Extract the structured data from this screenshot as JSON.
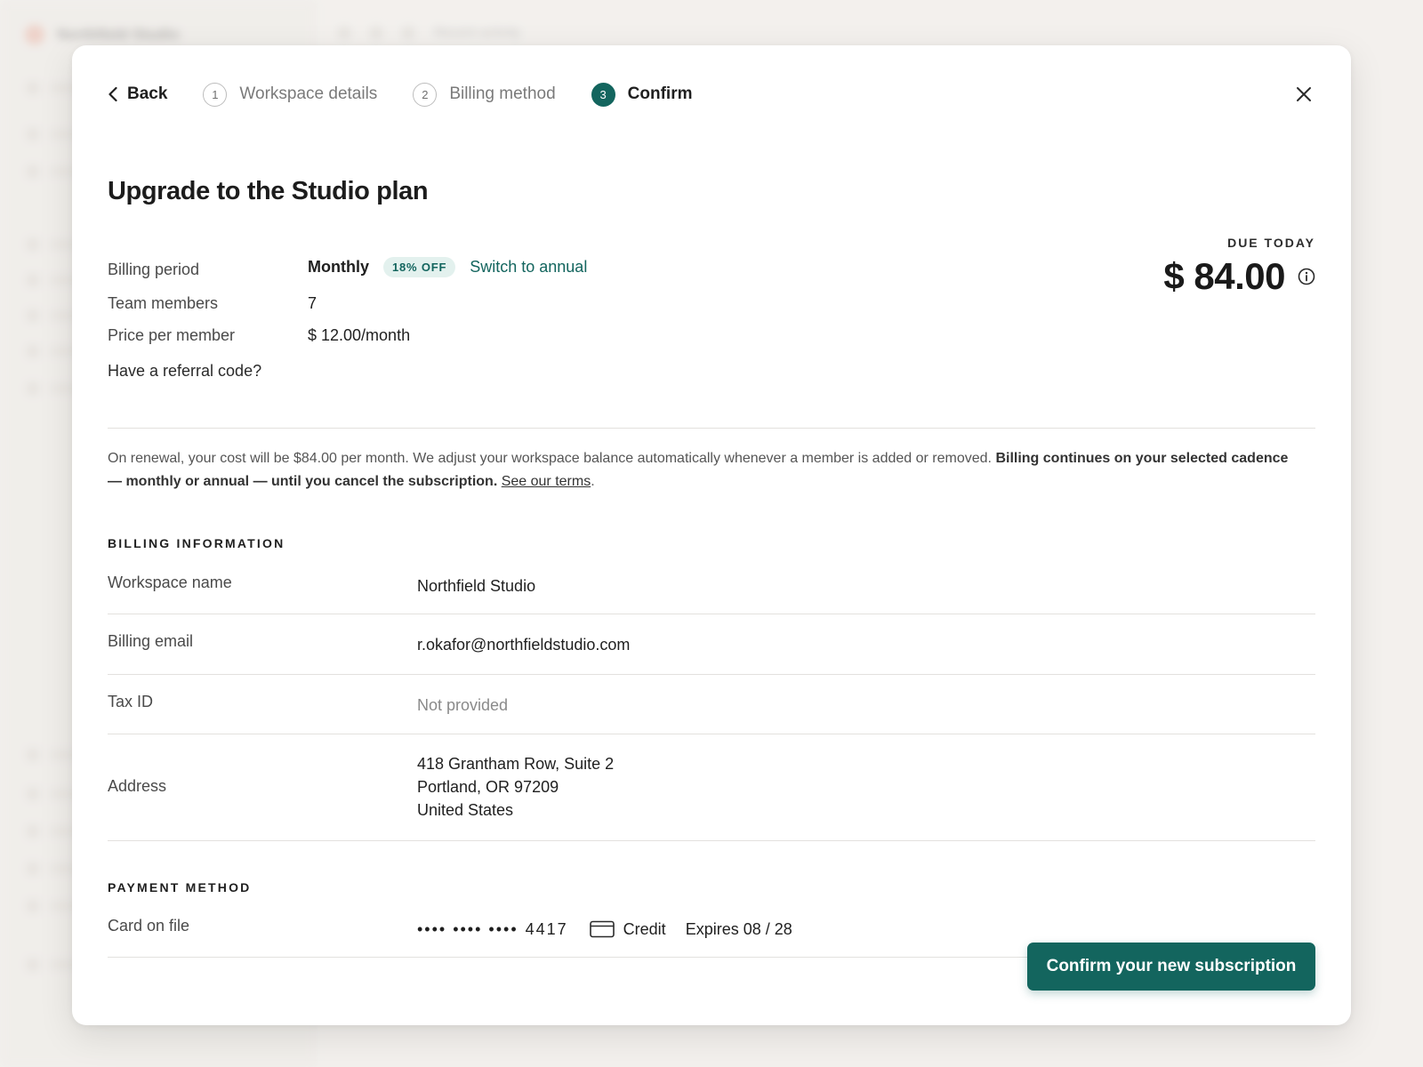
{
  "background": {
    "brand": "Northfield Studio",
    "topbar_label": "Recent activity"
  },
  "nav": {
    "back_label": "Back",
    "steps": [
      {
        "number": "1",
        "label": "Workspace details",
        "state": "done"
      },
      {
        "number": "2",
        "label": "Billing method",
        "state": "done"
      },
      {
        "number": "3",
        "label": "Confirm",
        "state": "active"
      }
    ]
  },
  "title": "Upgrade to the Studio plan",
  "summary": {
    "billing_period_label": "Billing period",
    "billing_period_value": "Monthly",
    "discount_badge": "18% OFF",
    "switch_link": "Switch to annual",
    "team_members_label": "Team members",
    "team_members_value": "7",
    "price_label": "Price per member",
    "price_value": "$ 12.00/month",
    "referral_link": "Have a referral code?"
  },
  "due": {
    "label": "DUE TODAY",
    "amount": "$ 84.00"
  },
  "renewal": {
    "text": "On renewal, your cost will be $84.00 per month. We adjust your workspace balance automatically whenever a member is added or removed. ",
    "bold": "Billing continues on your selected cadence — monthly or annual — until you cancel the subscription.",
    "link": "See our terms",
    "end": "."
  },
  "billing_info": {
    "heading": "BILLING INFORMATION",
    "rows": [
      {
        "label": "Workspace name",
        "value": "Northfield Studio"
      },
      {
        "label": "Billing email",
        "value": "r.okafor@northfieldstudio.com"
      },
      {
        "label": "Tax ID",
        "value": "Not provided"
      },
      {
        "label": "Address",
        "lines": [
          "418 Grantham Row, Suite 2",
          "Portland, OR 97209",
          "United States"
        ]
      }
    ]
  },
  "payment": {
    "heading": "PAYMENT METHOD",
    "label": "Card on file",
    "masked": "•••• •••• ••••",
    "last4": "4417",
    "card_type": "Credit",
    "expires": "Expires 08 / 28"
  },
  "confirm_button": "Confirm your new subscription",
  "colors": {
    "accent": "#13655e",
    "badge_bg": "#e3f1ee"
  }
}
